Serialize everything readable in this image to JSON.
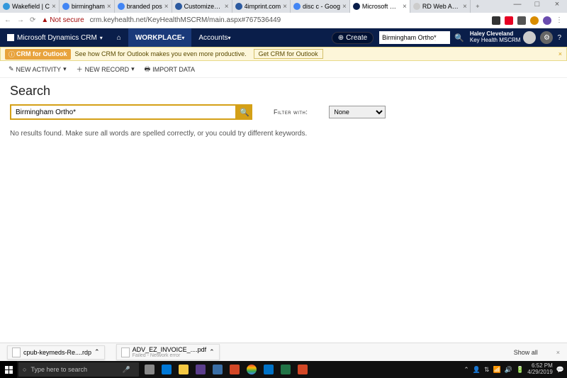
{
  "browser": {
    "tabs": [
      {
        "label": "Wakefield | C",
        "active": false
      },
      {
        "label": "birmingham",
        "active": false
      },
      {
        "label": "branded pos",
        "active": false
      },
      {
        "label": "Customized V",
        "active": false
      },
      {
        "label": "4imprint.com",
        "active": false
      },
      {
        "label": "disc c - Goog",
        "active": false
      },
      {
        "label": "Microsoft Dyn",
        "active": true
      },
      {
        "label": "RD Web Acce",
        "active": false
      }
    ],
    "secure": "Not secure",
    "url": "crm.keyhealth.net/KeyHealthMSCRM/main.aspx#767536449"
  },
  "crm": {
    "app_name": "Microsoft Dynamics CRM",
    "workplace": "WORKPLACE",
    "accounts": "Accounts",
    "create": "Create",
    "top_search": "Birmingham Ortho*",
    "user_name": "Haley Cleveland",
    "user_org": "Key Health MSCRM",
    "notify_tag": "CRM for Outlook",
    "notify_text": "See how CRM for Outlook makes you even more productive.",
    "notify_btn": "Get CRM for Outlook",
    "tool_new_activity": "NEW ACTIVITY",
    "tool_new_record": "NEW RECORD",
    "tool_import": "IMPORT DATA",
    "page_title": "Search",
    "search_value": "Birmingham Ortho*",
    "filter_label": "Filter with:",
    "filter_value": "None",
    "no_results": "No results found. Make sure all words are spelled correctly, or you could try different keywords."
  },
  "downloads": {
    "file1": "cpub-keymeds-Re....rdp",
    "file2": "ADV_EZ_INVOICE_....pdf",
    "file2_sub": "Failed - Network error",
    "showall": "Show all"
  },
  "taskbar": {
    "search_placeholder": "Type here to search",
    "time": "6:52 PM",
    "date": "4/29/2019"
  }
}
